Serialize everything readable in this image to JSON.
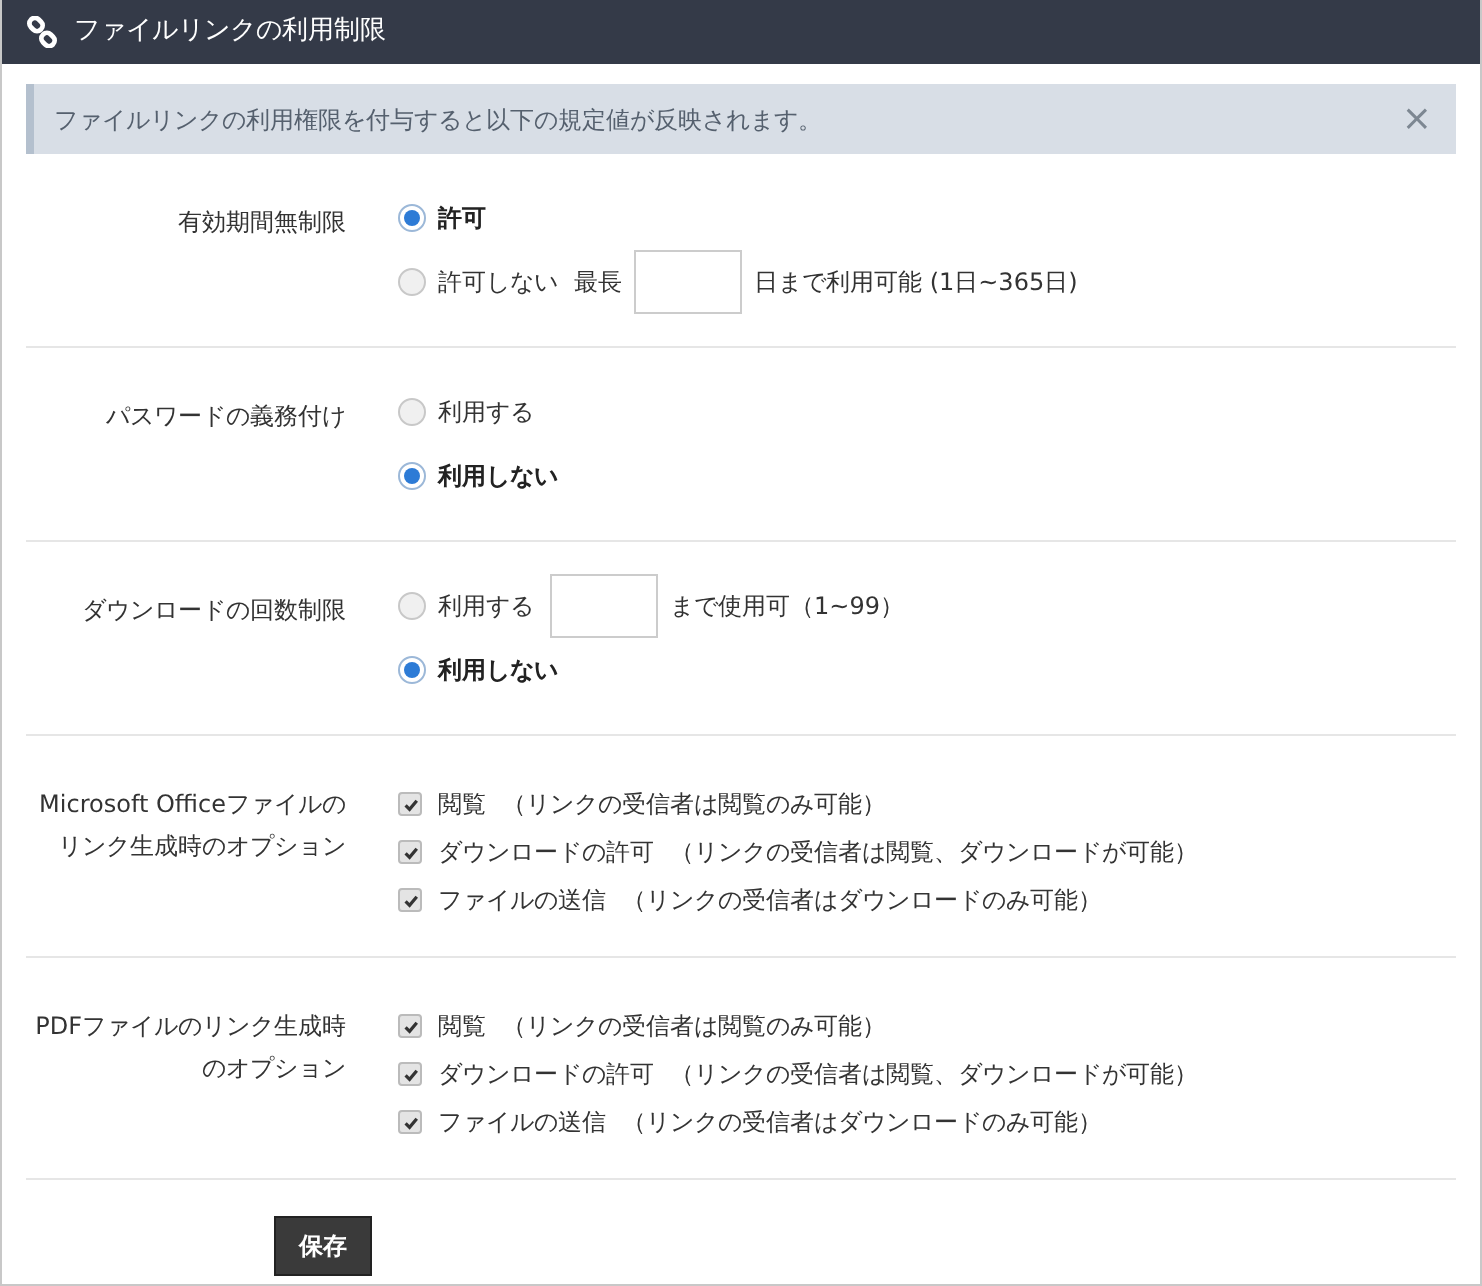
{
  "header": {
    "title": "ファイルリンクの利用制限"
  },
  "alert": {
    "text": "ファイルリンクの利用権限を付与すると以下の規定値が反映されます。",
    "close": "×"
  },
  "sections": [
    {
      "kind": "radio",
      "label": "有効期間無制限",
      "options": [
        {
          "kind": "plain",
          "label": "許可",
          "selected": true
        },
        {
          "kind": "with_field",
          "label": "許可しない",
          "prefix": "最長",
          "suffix": "日まで利用可能 (1日~365日)",
          "selected": false
        }
      ]
    },
    {
      "kind": "radio",
      "label": "パスワードの義務付け",
      "options": [
        {
          "kind": "plain",
          "label": "利用する",
          "selected": false
        },
        {
          "kind": "plain",
          "label": "利用しない",
          "selected": true
        }
      ]
    },
    {
      "kind": "radio",
      "label": "ダウンロードの回数制限",
      "options": [
        {
          "kind": "with_field",
          "label": "利用する",
          "suffix": "まで使用可（1~99）",
          "selected": false
        },
        {
          "kind": "plain",
          "label": "利用しない",
          "selected": true
        }
      ]
    },
    {
      "kind": "check",
      "label": "Microsoft Officeファイルのリンク生成時のオプション",
      "options": [
        {
          "label": "閲覧",
          "note": "（リンクの受信者は閲覧のみ可能）",
          "checked": true
        },
        {
          "label": "ダウンロードの許可",
          "note": "（リンクの受信者は閲覧、ダウンロードが可能）",
          "checked": true
        },
        {
          "label": "ファイルの送信",
          "note": "（リンクの受信者はダウンロードのみ可能）",
          "checked": true
        }
      ]
    },
    {
      "kind": "check",
      "label": "PDFファイルのリンク生成時のオプション",
      "options": [
        {
          "label": "閲覧",
          "note": "（リンクの受信者は閲覧のみ可能）",
          "checked": true
        },
        {
          "label": "ダウンロードの許可",
          "note": "（リンクの受信者は閲覧、ダウンロードが可能）",
          "checked": true
        },
        {
          "label": "ファイルの送信",
          "note": "（リンクの受信者はダウンロードのみ可能）",
          "checked": true
        }
      ]
    }
  ],
  "save_button": "保存"
}
